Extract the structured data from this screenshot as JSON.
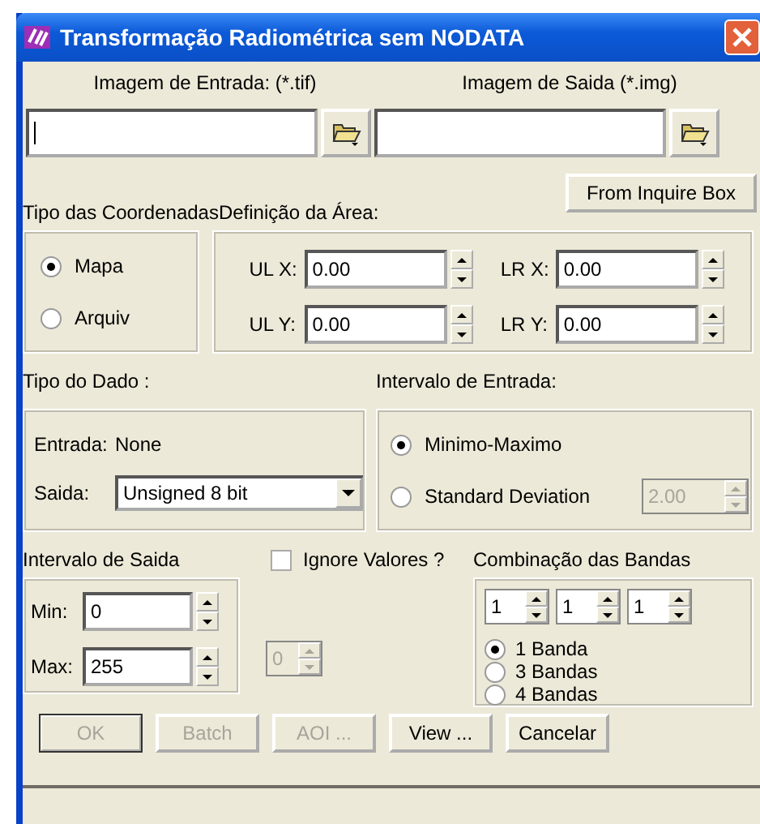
{
  "window": {
    "title": "Transformação Radiométrica sem NODATA"
  },
  "files": [
    {
      "label": "Imagem de Entrada: (*.tif)",
      "cursor": true
    },
    {
      "label": "Imagem de Saida (*.img)",
      "cursor": false
    }
  ],
  "coordinates": {
    "label": "Tipo das Coordenadas",
    "options": [
      {
        "label": "Mapa",
        "selected": true
      },
      {
        "label": "Arquiv",
        "selected": false
      }
    ]
  },
  "area": {
    "label": "Definição da Área:",
    "inquire_button": "From Inquire Box",
    "fields": [
      {
        "label": "UL X:",
        "value": "0.00"
      },
      {
        "label": "LR X:",
        "value": "0.00"
      },
      {
        "label": "UL Y:",
        "value": "0.00"
      },
      {
        "label": "LR Y:",
        "value": "0.00"
      }
    ]
  },
  "data_type": {
    "label": "Tipo do Dado :",
    "input_label": "Entrada:",
    "input_value": "None",
    "output_label": "Saida:",
    "output_value": "Unsigned 8 bit"
  },
  "input_range": {
    "label": "Intervalo de Entrada:",
    "options": [
      {
        "label": "Minimo-Maximo",
        "selected": true
      },
      {
        "label": "Standard Deviation",
        "selected": false
      }
    ],
    "deviation": {
      "value": "2.00",
      "disabled": true
    }
  },
  "output_range": {
    "label": "Intervalo de Saida",
    "min_label": "Min:",
    "min": "0",
    "max_label": "Max:",
    "max": "255"
  },
  "ignore": {
    "label": "Ignore Valores ?",
    "checked": false,
    "value": "0",
    "disabled": true
  },
  "bands": {
    "label": "Combinação das Bandas",
    "values": [
      "1",
      "1",
      "1"
    ],
    "options": [
      {
        "label": "1 Banda",
        "selected": true
      },
      {
        "label": "3 Bandas",
        "selected": false
      },
      {
        "label": "4 Bandas",
        "selected": false
      }
    ]
  },
  "buttons": [
    {
      "label": "OK",
      "disabled": true
    },
    {
      "label": "Batch",
      "disabled": true
    },
    {
      "label": "AOI ...",
      "disabled": true
    },
    {
      "label": "View ...",
      "disabled": false
    },
    {
      "label": "Cancelar",
      "disabled": false
    }
  ]
}
